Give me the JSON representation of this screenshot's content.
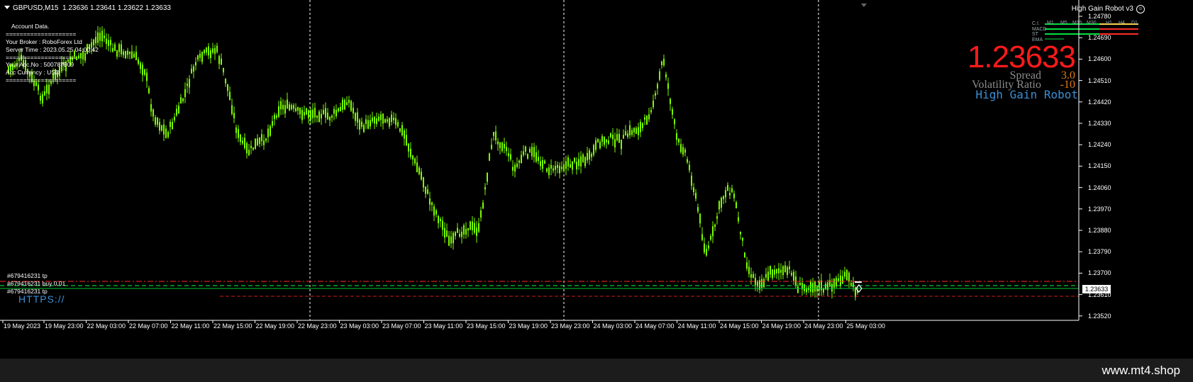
{
  "chart": {
    "symbol": "GBPUSD,M15",
    "ohlc": "1.23636 1.23641 1.23622 1.23633",
    "ea_name": "High Gain Robot v3",
    "colors": {
      "bull": "#7CFC00",
      "bear": "#7CFC00",
      "background": "#000000",
      "ask_line": "#ff2a2a",
      "bid_line": "#00ff3a"
    }
  },
  "account": {
    "header": "Account Data.",
    "separator": "====================",
    "broker": "Your Broker : RoboForex Ltd",
    "server_time": "Server Time : 2023.05.25 04:00:42",
    "acc_no": "Your Acc.No : 500787909",
    "currency": "Acc Currency : USD"
  },
  "panel": {
    "price": "1.23633",
    "spread_label": "Spread",
    "spread_value": "3.0",
    "volatility_label": "Volatility Ratio",
    "volatility_value": "-10",
    "robot_name": "High Gain Robot",
    "mtf_rows": [
      "C.I.",
      "MACD",
      "ST",
      "EMA"
    ],
    "mtf_timeframes": [
      "M1",
      "M5",
      "M15",
      "M30",
      "H1",
      "H4",
      "D1"
    ]
  },
  "orders": {
    "tp1": "#679416231 tp",
    "buy": "#679416231 buy 0.01",
    "tp2": "#679416231 tp",
    "link": "HTTPS://"
  },
  "price_axis": [
    "1.24780",
    "1.24690",
    "1.24600",
    "1.24510",
    "1.24420",
    "1.24330",
    "1.24240",
    "1.24150",
    "1.24060",
    "1.23970",
    "1.23880",
    "1.23790",
    "1.23700",
    "1.23610",
    "1.23520"
  ],
  "current_price_box": "1.23633",
  "time_axis": [
    "19 May 2023",
    "19 May 23:00",
    "22 May 03:00",
    "22 May 07:00",
    "22 May 11:00",
    "22 May 15:00",
    "22 May 19:00",
    "22 May 23:00",
    "23 May 03:00",
    "23 May 07:00",
    "23 May 11:00",
    "23 May 15:00",
    "23 May 19:00",
    "23 May 23:00",
    "24 May 03:00",
    "24 May 07:00",
    "24 May 11:00",
    "24 May 15:00",
    "24 May 19:00",
    "24 May 23:00",
    "25 May 03:00"
  ],
  "footer": {
    "url": "www.mt4.shop"
  }
}
